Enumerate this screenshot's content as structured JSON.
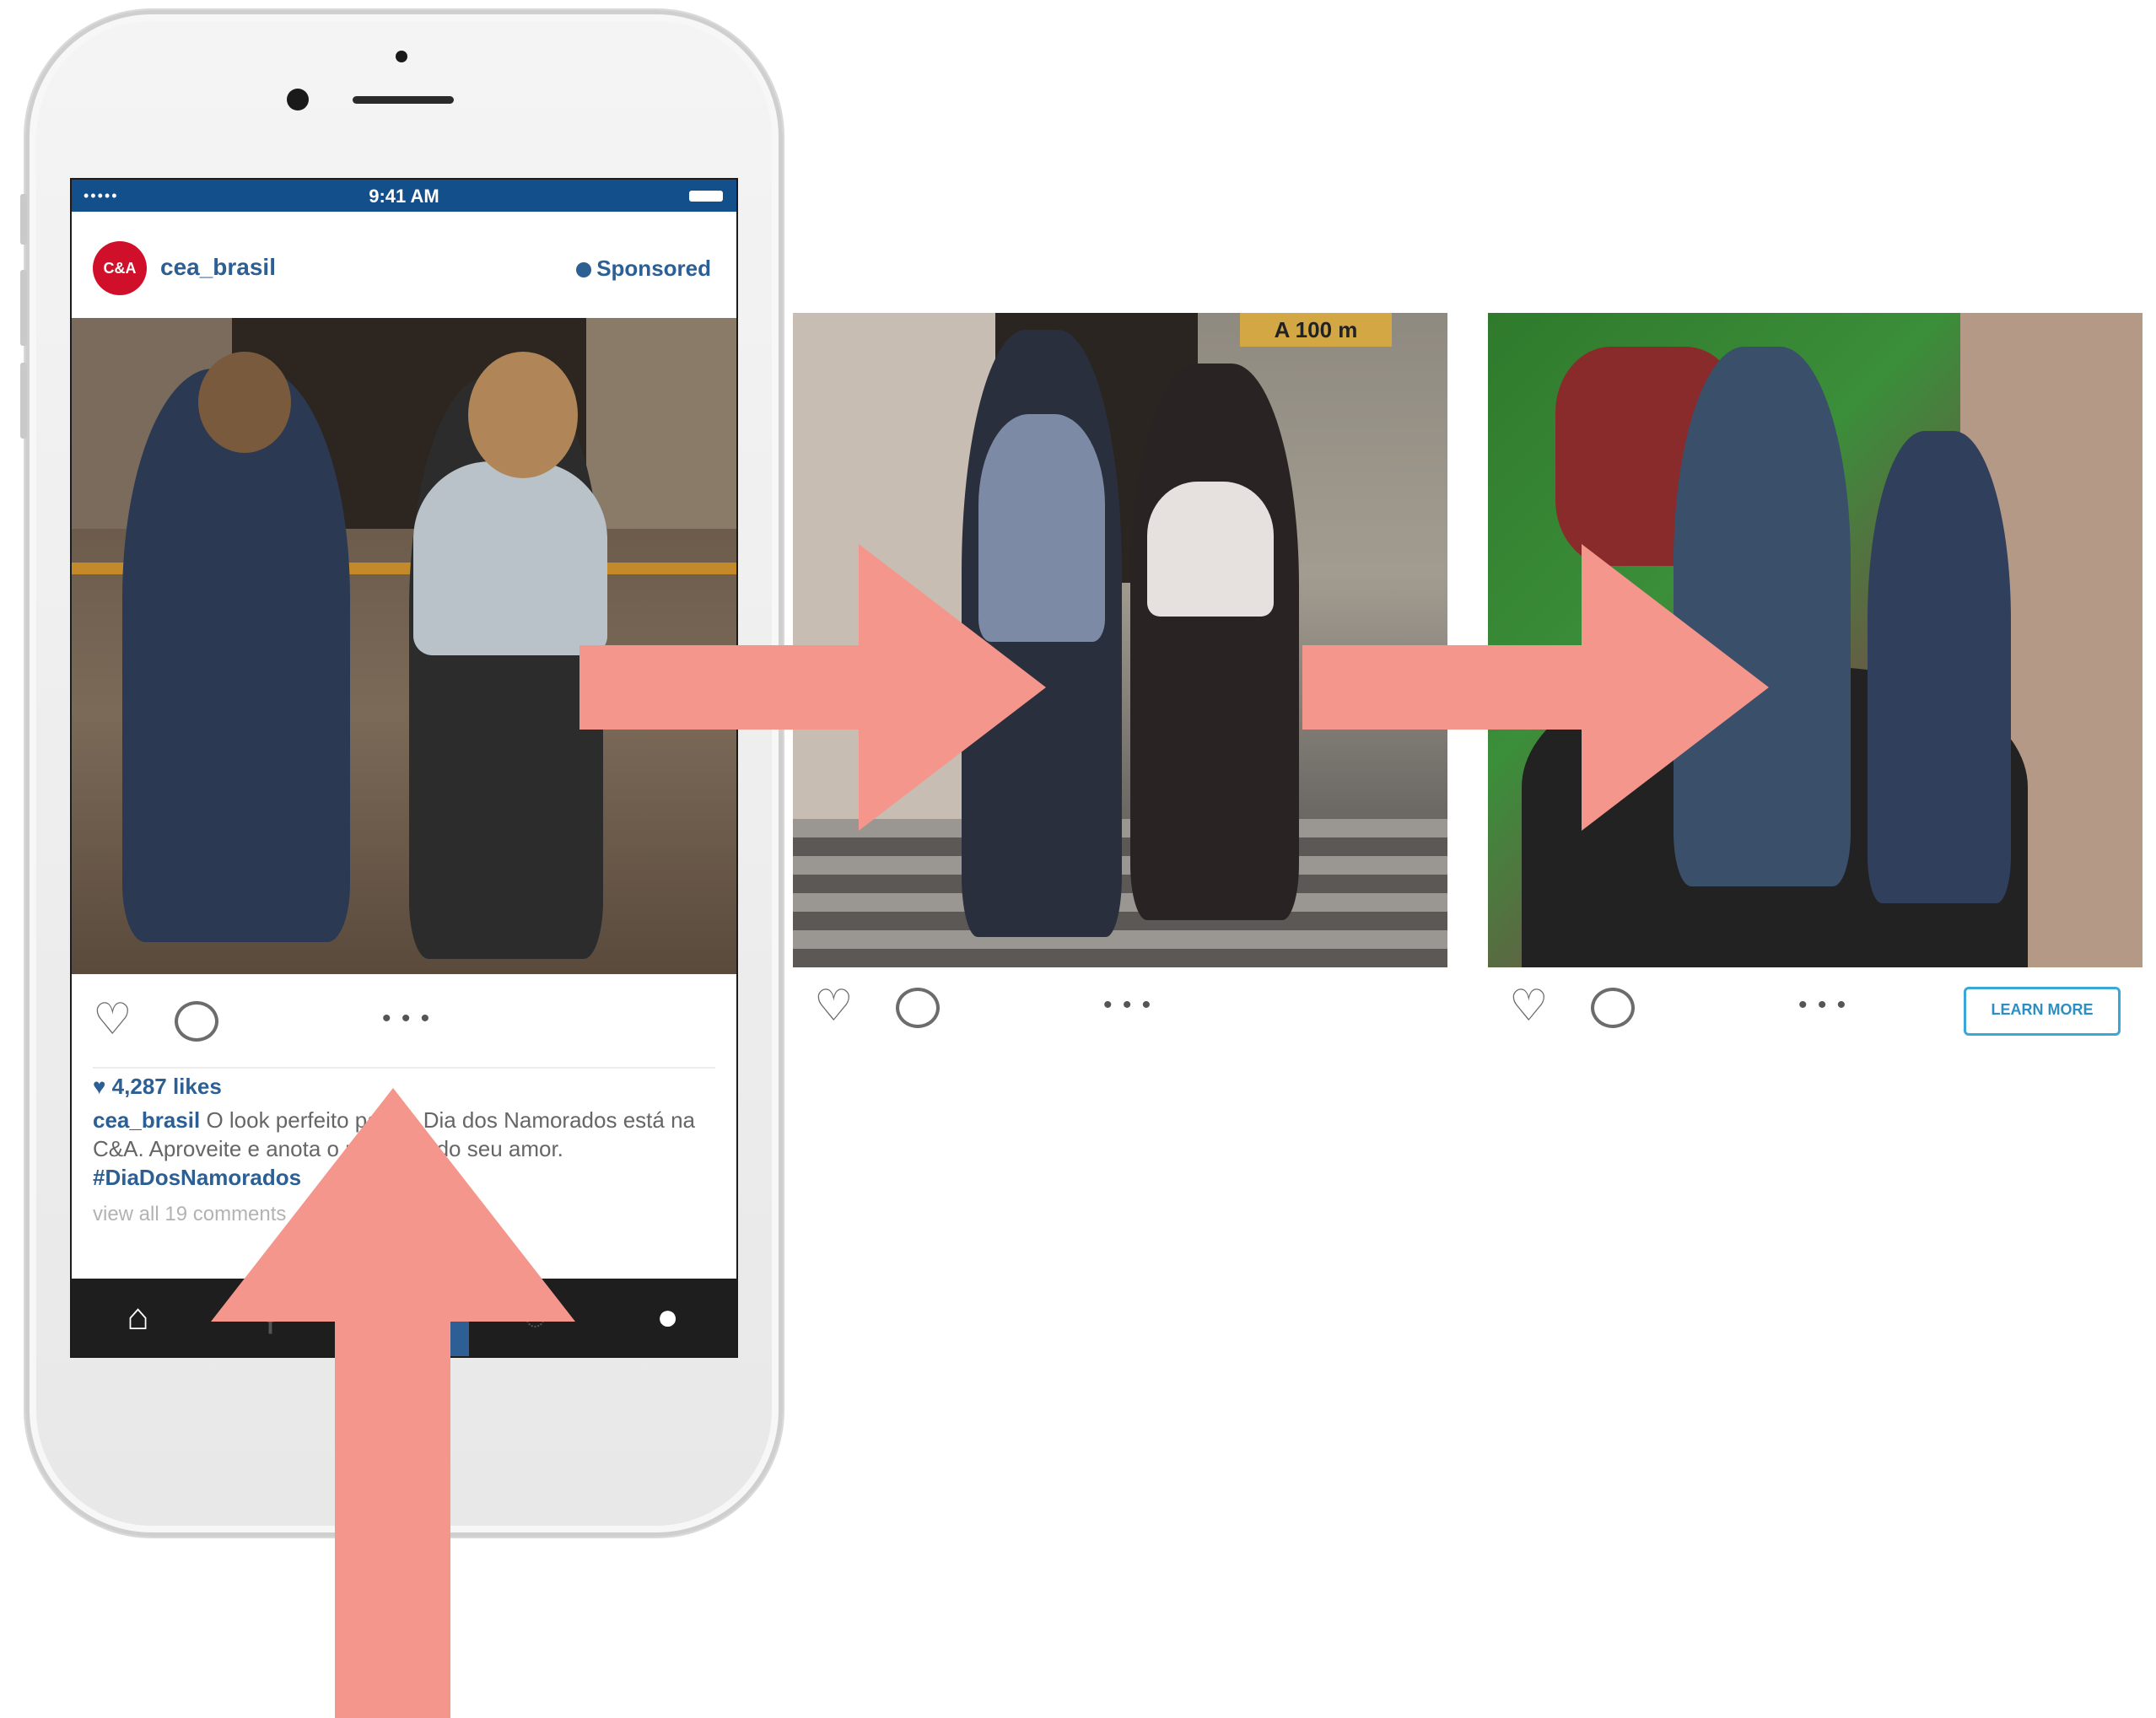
{
  "status_bar": {
    "signal": "•••••",
    "time": "9:41 AM"
  },
  "post": {
    "avatar_text": "C&A",
    "username": "cea_brasil",
    "sponsored_label": "Sponsored",
    "likes": "4,287 likes",
    "caption_user": "cea_brasil",
    "caption_text": " O look perfeito para o Dia dos Namorados está na C&A. Aproveite e anota o presente do seu amor. ",
    "caption_hashtag": "#DiaDosNamorados",
    "view_all": "view all 19 comments"
  },
  "carousel": {
    "pager": "• • •",
    "learn_more_label": "LEARN MORE",
    "card2_sign": "A 100 m"
  },
  "icons": {
    "heart": "heart-icon",
    "comment": "comment-icon",
    "home": "home-icon",
    "search": "search-icon",
    "camera": "camera-icon",
    "activity": "activity-icon",
    "profile": "profile-icon"
  },
  "colors": {
    "arrow": "#f5968c",
    "brand_blue": "#2c5f93",
    "status_bar": "#134f8a",
    "avatar_red": "#d0102b",
    "learn_more_border": "#3aa7d9"
  }
}
